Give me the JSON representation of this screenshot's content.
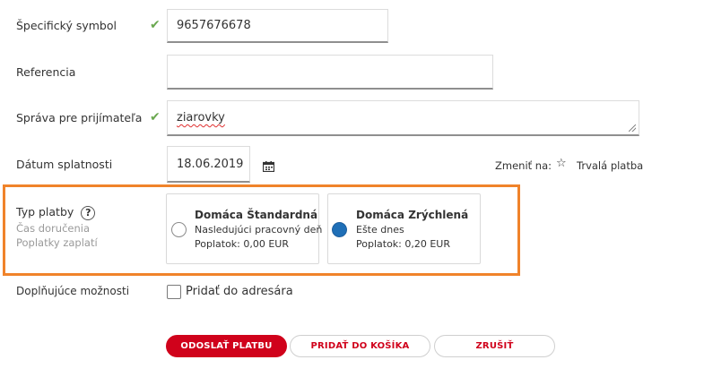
{
  "form": {
    "specific_symbol": {
      "label": "Špecifický symbol",
      "value": "9657676678"
    },
    "reference": {
      "label": "Referencia",
      "value": ""
    },
    "message": {
      "label": "Správa pre prijímateľa",
      "value": "ziarovky"
    },
    "due_date": {
      "label": "Dátum splatnosti",
      "value": "18.06.2019"
    },
    "change_to": {
      "label": "Zmeniť na:",
      "link": "Trvalá platba"
    }
  },
  "payment_type": {
    "label": "Typ platby",
    "help": "?",
    "delivery_label": "Čas doručenia",
    "fees_label": "Poplatky zaplatí",
    "options": [
      {
        "title": "Domáca Štandardná",
        "delivery": "Nasledujúci pracovný deň",
        "fee": "Poplatok: 0,00 EUR",
        "selected": false
      },
      {
        "title": "Domáca Zrýchlená",
        "delivery": "Ešte dnes",
        "fee": "Poplatok: 0,20 EUR",
        "selected": true
      }
    ]
  },
  "extra": {
    "label": "Doplňujúce možnosti",
    "add_to_address_book": "Pridať do adresára"
  },
  "actions": {
    "send": "ODOSLAŤ PLATBU",
    "add_to_cart": "PRIDAŤ DO KOŠÍKA",
    "cancel": "ZRUŠIŤ"
  },
  "colors": {
    "accent_red": "#d0021b",
    "highlight_orange": "#f0832a",
    "check_green": "#6aa84f",
    "radio_blue": "#1f6fb7"
  }
}
